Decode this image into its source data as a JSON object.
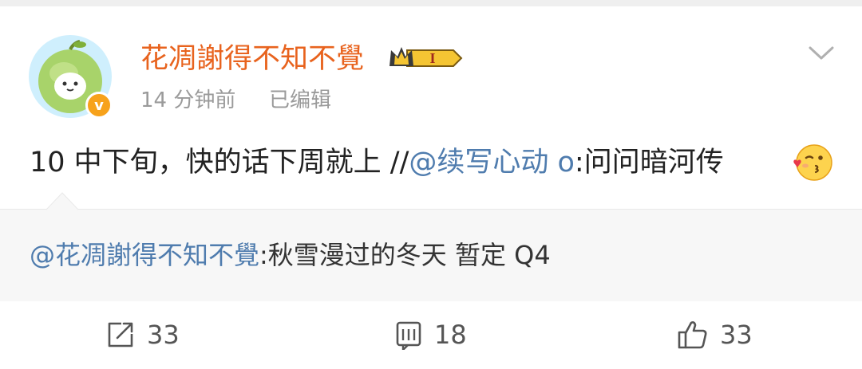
{
  "post": {
    "author": "花凋謝得不知不覺",
    "verified_badge": "v",
    "level_badge": "I",
    "time": "14 分钟前",
    "edited": "已编辑",
    "content": {
      "text": "10 中下旬，快的话下周就上 //",
      "mention": "@续写心动 o",
      "suffix": ":问问暗河传"
    }
  },
  "quote": {
    "mention": "@花凋謝得不知不覺",
    "text": ":秋雪漫过的冬天 暂定 Q4"
  },
  "actions": {
    "repost_count": "33",
    "comment_count": "18",
    "like_count": "33"
  },
  "colors": {
    "author": "#e8631e",
    "mention": "#4f7cae",
    "meta": "#9a9a9a",
    "verified": "#f7a21b"
  },
  "icons": [
    "apple-avatar",
    "verified-icon",
    "crown-level-icon",
    "chevron-down-icon",
    "kiss-emoji-icon",
    "repost-icon",
    "comment-icon",
    "like-icon"
  ]
}
